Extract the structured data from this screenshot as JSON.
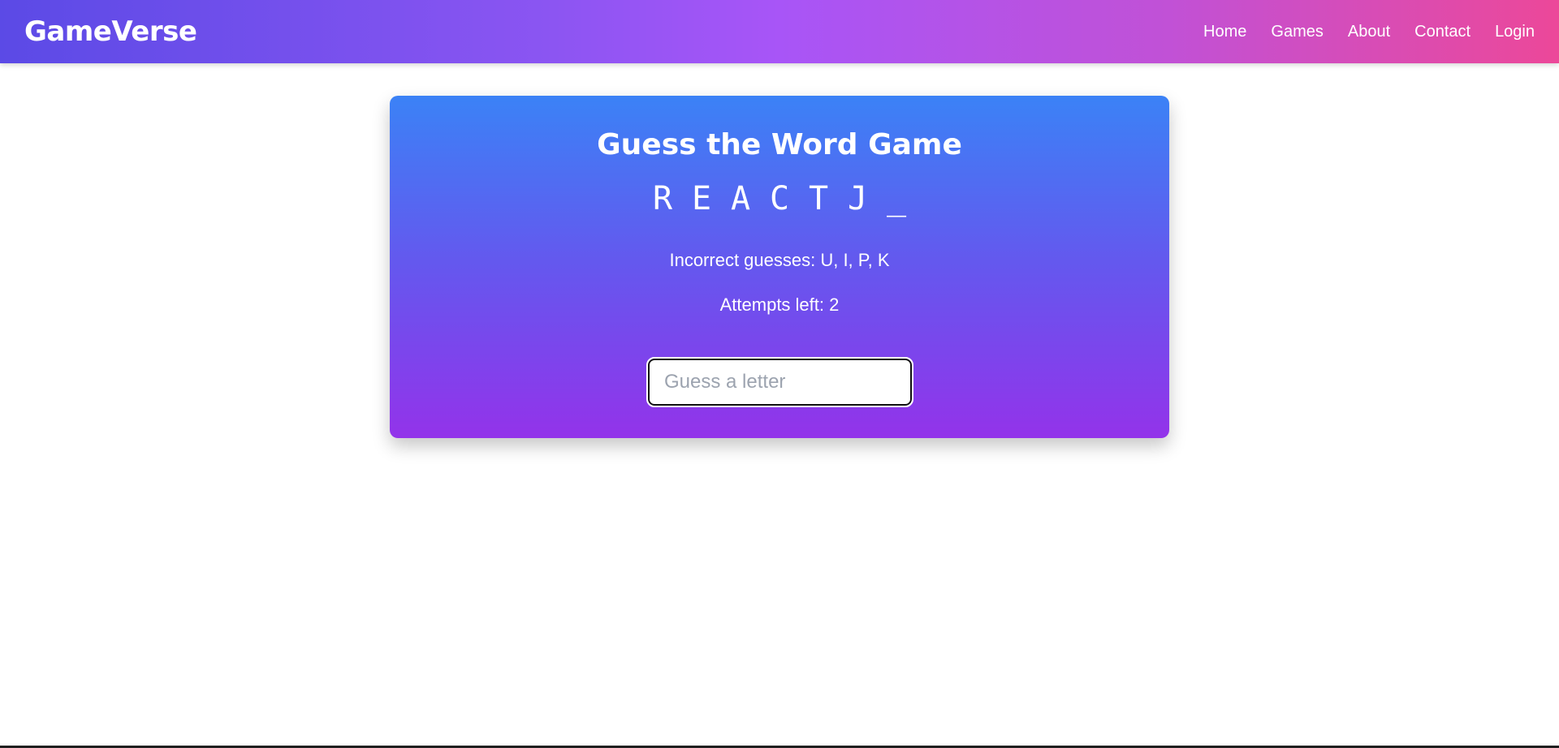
{
  "header": {
    "brand": "GameVerse",
    "nav": [
      {
        "label": "Home"
      },
      {
        "label": "Games"
      },
      {
        "label": "About"
      },
      {
        "label": "Contact"
      },
      {
        "label": "Login"
      }
    ]
  },
  "game": {
    "title": "Guess the Word Game",
    "word_display": [
      "R",
      "E",
      "A",
      "C",
      "T",
      "J",
      "_"
    ],
    "incorrect_text": "Incorrect guesses: U, I, P, K",
    "attempts_text": "Attempts left: 2",
    "input": {
      "placeholder": "Guess a letter",
      "value": ""
    }
  },
  "colors": {
    "header_gradient": [
      "#5b4ae6",
      "#a855f7",
      "#ec4899"
    ],
    "card_gradient": [
      "#3b82f6",
      "#9333ea"
    ]
  }
}
